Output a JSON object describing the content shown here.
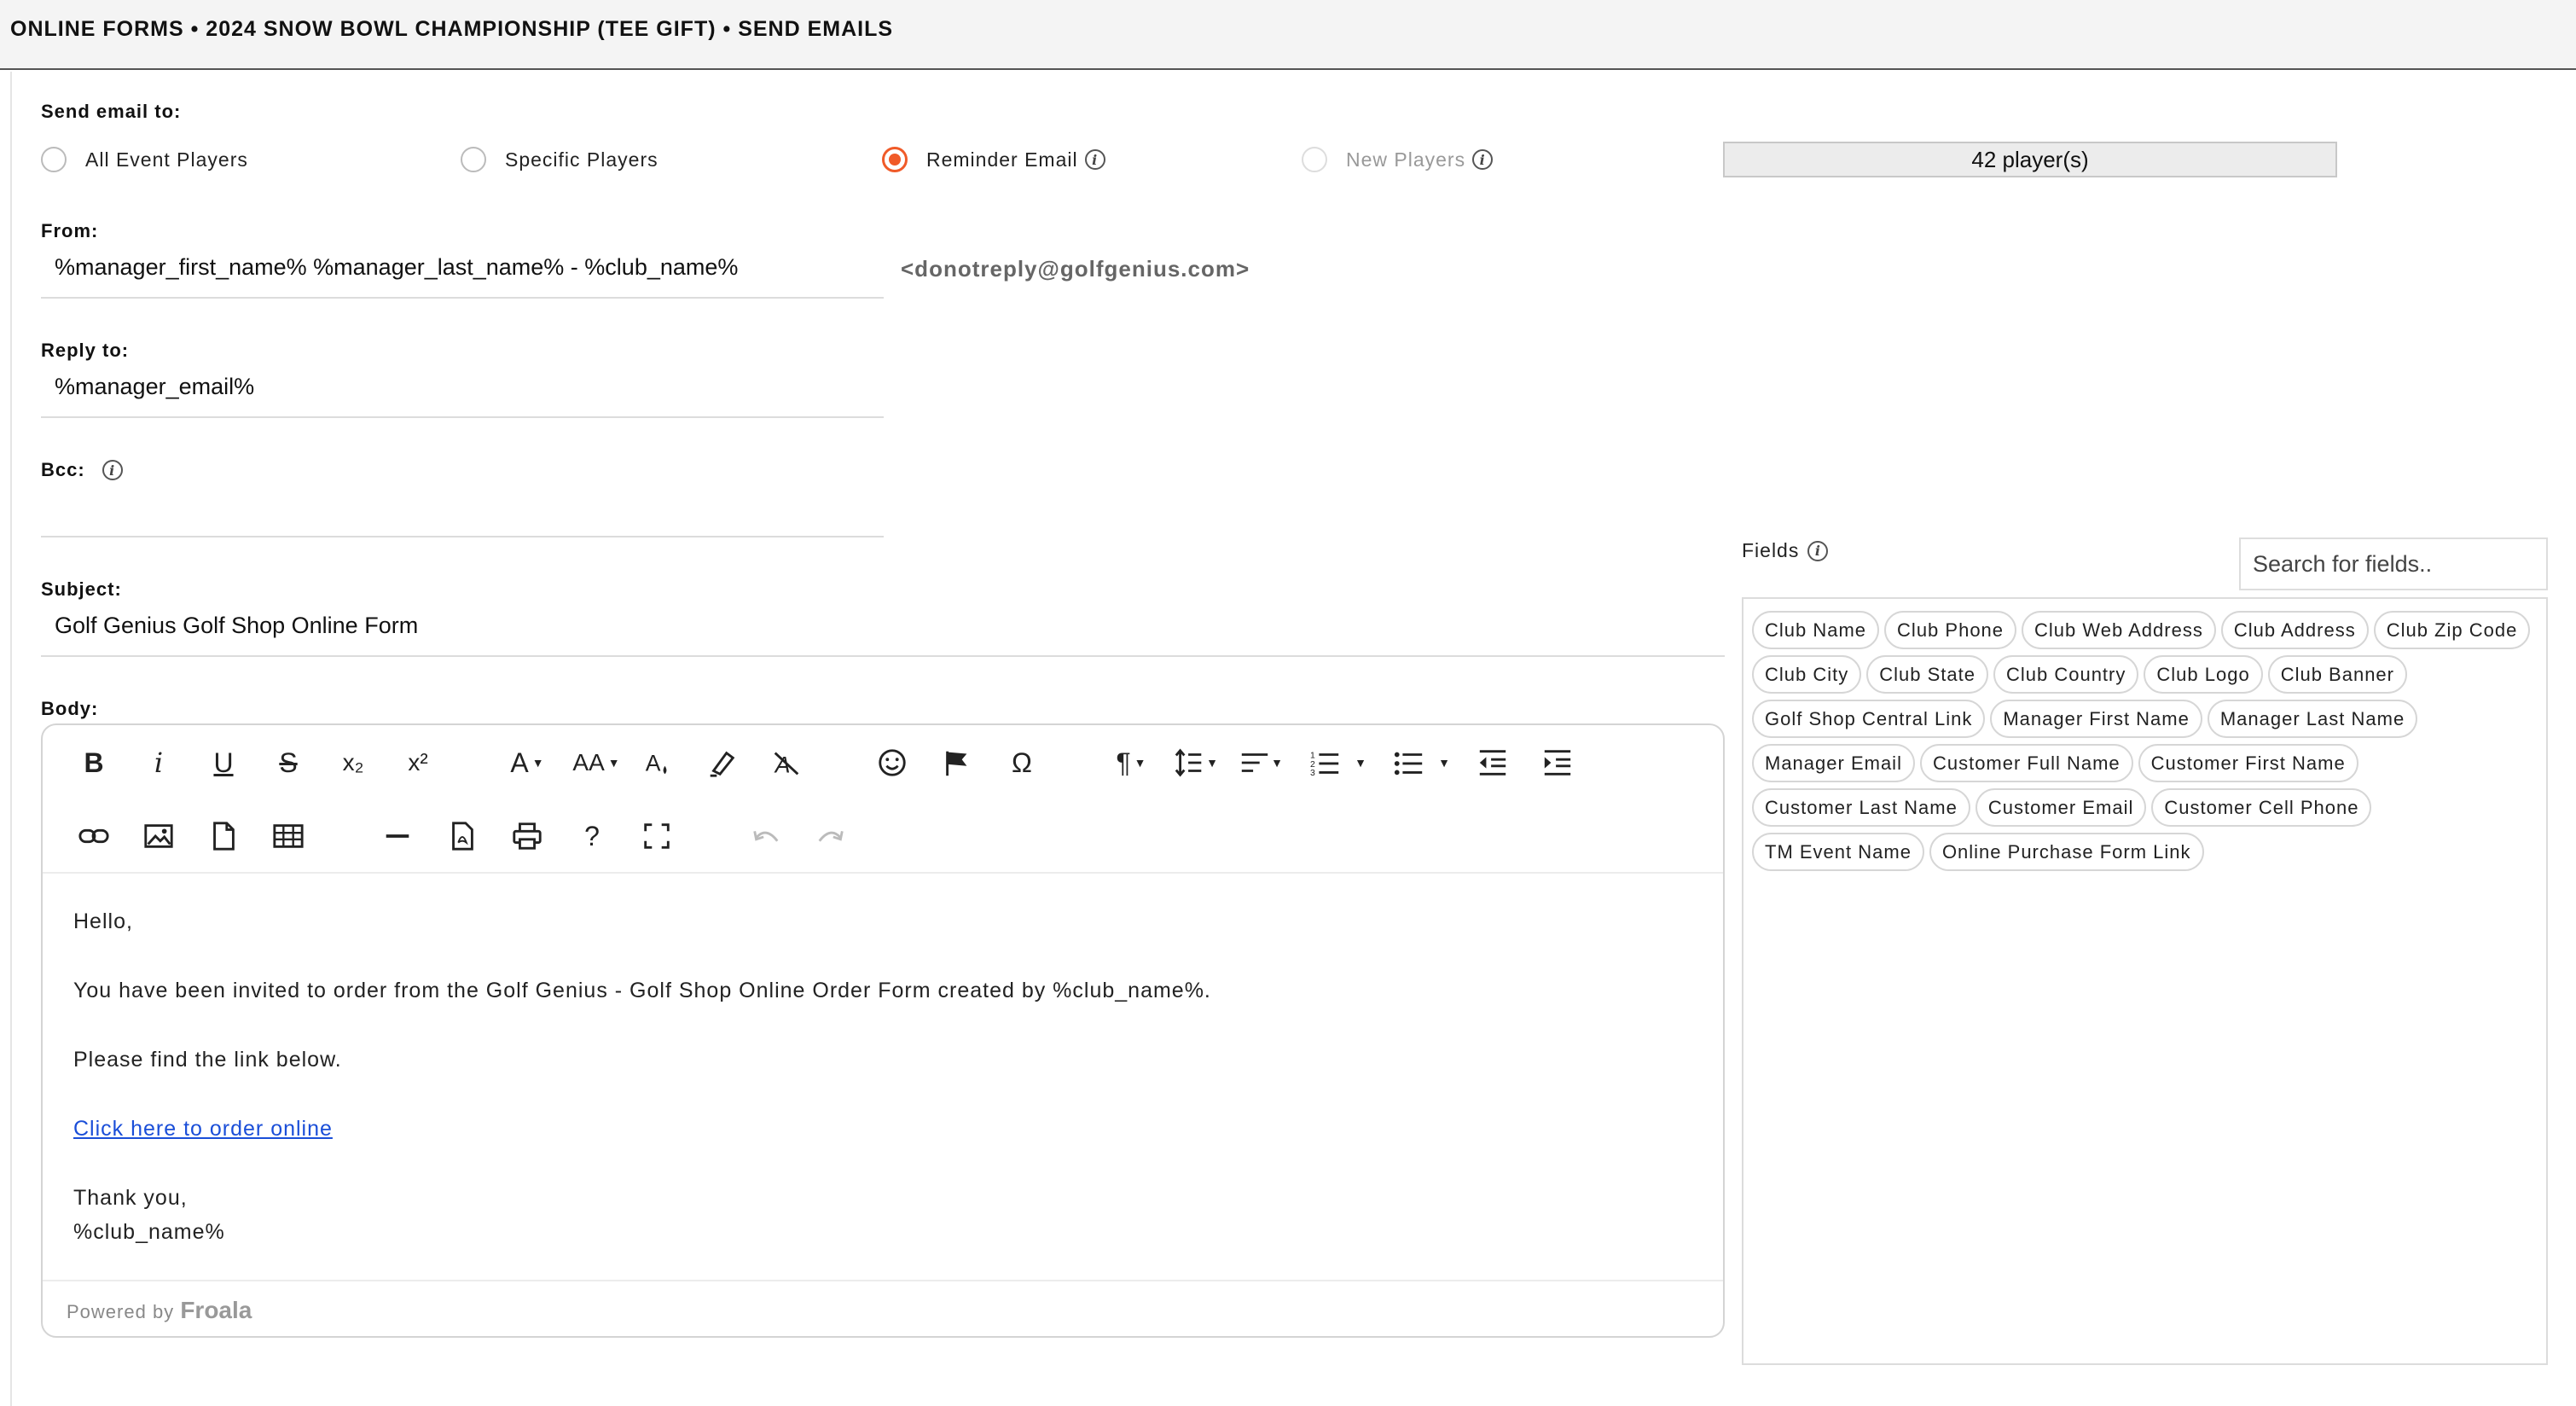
{
  "header": {
    "breadcrumb": "ONLINE FORMS • 2024 SNOW BOWL CHAMPIONSHIP (TEE GIFT) • SEND EMAILS"
  },
  "send_to": {
    "label": "Send email to:",
    "options": [
      {
        "label": "All Event Players",
        "selected": false,
        "disabled": false
      },
      {
        "label": "Specific Players",
        "selected": false,
        "disabled": false
      },
      {
        "label": "Reminder Email",
        "selected": true,
        "disabled": false
      },
      {
        "label": "New Players",
        "selected": false,
        "disabled": true
      }
    ],
    "player_count": "42 player(s)"
  },
  "from": {
    "label": "From:",
    "value": "%manager_first_name% %manager_last_name% - %club_name%",
    "sender_address": "<donotreply@golfgenius.com>"
  },
  "reply_to": {
    "label": "Reply to:",
    "value": "%manager_email%"
  },
  "bcc": {
    "label": "Bcc:",
    "value": ""
  },
  "subject": {
    "label": "Subject:",
    "value": "Golf Genius Golf Shop Online Form"
  },
  "body": {
    "label": "Body:",
    "greeting": "Hello,",
    "line1": "You have been invited to order from the Golf Genius - Golf Shop Online Order Form created by %club_name%.",
    "line2": "Please find the link below.",
    "link_text": "Click here to order online",
    "closing1": "Thank you,",
    "closing2": "%club_name%",
    "powered_by": "Powered by",
    "powered_brand": "Froala"
  },
  "toolbar": {
    "bold": "B",
    "italic": "i",
    "underline": "U",
    "strike": "S",
    "subscript": "x₂",
    "superscript": "x²",
    "font_family": "A",
    "font_size": "AA",
    "omega": "Ω",
    "paragraph": "¶",
    "help": "?"
  },
  "fields": {
    "label": "Fields",
    "search_placeholder": "Search for fields..",
    "tags": [
      "Club Name",
      "Club Phone",
      "Club Web Address",
      "Club Address",
      "Club Zip Code",
      "Club City",
      "Club State",
      "Club Country",
      "Club Logo",
      "Club Banner",
      "Golf Shop Central Link",
      "Manager First Name",
      "Manager Last Name",
      "Manager Email",
      "Customer Full Name",
      "Customer First Name",
      "Customer Last Name",
      "Customer Email",
      "Customer Cell Phone",
      "TM Event Name",
      "Online Purchase Form Link"
    ]
  },
  "colors": {
    "accent": "#f05a28",
    "link": "#1a4ed8"
  }
}
